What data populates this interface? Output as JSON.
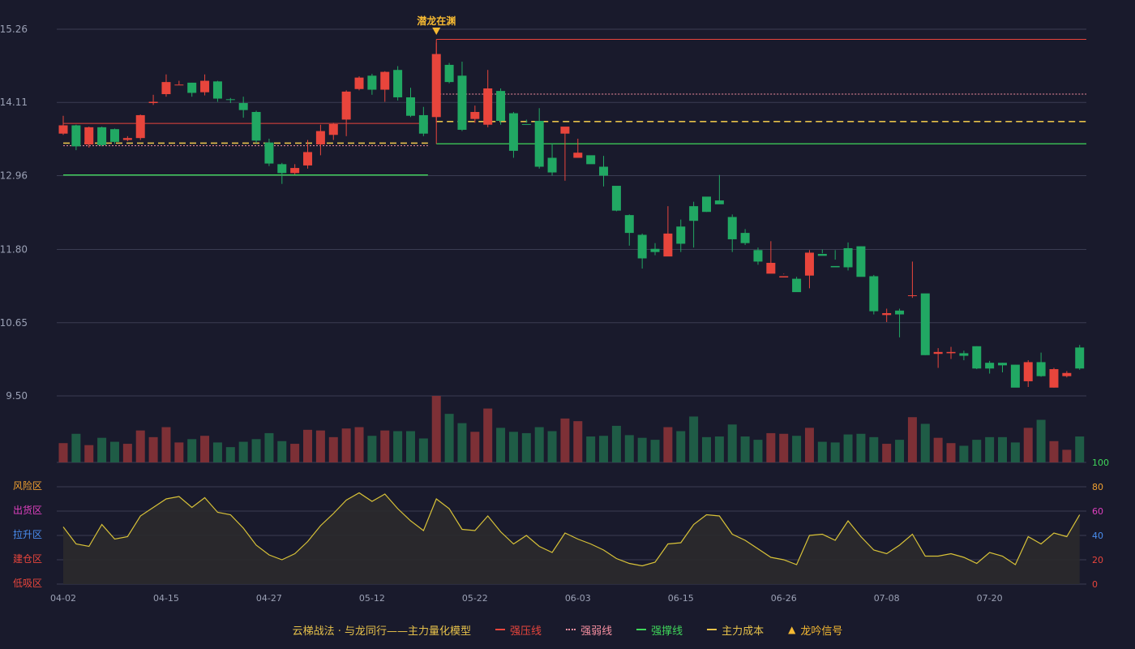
{
  "colors": {
    "background": "#191a2c",
    "up": "#e8453c",
    "down": "#21a863",
    "up_volume": "#7d3036",
    "down_volume": "#1f5c46",
    "grid": "#3a3c52",
    "axis_text": "#9aa0b4",
    "resistance": "#e8453c",
    "weak": "#f58fa0",
    "support": "#3fd65a",
    "cost": "#e6c14a",
    "signal": "#f5b932",
    "osc_line": "#d8c238",
    "osc_fill": "#2b2a2c",
    "zone_risk": "#f0a030",
    "zone_distribute": "#e040c0",
    "zone_rise": "#4a8ef0",
    "zone_build": "#e8453c",
    "zone_absorb": "#e8453c",
    "osc_axis_green": "#3fd65a",
    "osc_axis_orange": "#f0a030",
    "osc_axis_magenta": "#e040c0",
    "osc_axis_blue": "#4a8ef0",
    "osc_axis_red": "#e8453c"
  },
  "chart_data": {
    "type": "candlestick",
    "price_axis": {
      "ticks": [
        "15.26",
        "14.11",
        "12.96",
        "11.80",
        "10.65",
        "9.50"
      ],
      "range": [
        9.5,
        15.26
      ]
    },
    "x_tick_labels": [
      {
        "index": 0,
        "label": "04-02"
      },
      {
        "index": 8,
        "label": "04-15"
      },
      {
        "index": 16,
        "label": "04-27"
      },
      {
        "index": 24,
        "label": "05-12"
      },
      {
        "index": 32,
        "label": "05-22"
      },
      {
        "index": 40,
        "label": "06-03"
      },
      {
        "index": 48,
        "label": "06-15"
      },
      {
        "index": 56,
        "label": "06-26"
      },
      {
        "index": 64,
        "label": "07-08"
      },
      {
        "index": 72,
        "label": "07-20"
      }
    ],
    "candles": [
      [
        13.62,
        13.75,
        13.6,
        13.9
      ],
      [
        13.75,
        13.42,
        13.36,
        13.76
      ],
      [
        13.45,
        13.72,
        13.4,
        13.73
      ],
      [
        13.72,
        13.44,
        13.42,
        13.73
      ],
      [
        13.69,
        13.49,
        13.46,
        13.7
      ],
      [
        13.52,
        13.55,
        13.5,
        13.58
      ],
      [
        13.55,
        13.91,
        13.52,
        13.92
      ],
      [
        14.1,
        14.12,
        14.07,
        14.23
      ],
      [
        14.24,
        14.43,
        14.2,
        14.55
      ],
      [
        14.39,
        14.39,
        14.39,
        14.45
      ],
      [
        14.42,
        14.26,
        14.2,
        14.42
      ],
      [
        14.27,
        14.45,
        14.22,
        14.55
      ],
      [
        14.44,
        14.17,
        14.12,
        14.45
      ],
      [
        14.16,
        14.15,
        14.1,
        14.18
      ],
      [
        14.1,
        13.99,
        13.87,
        14.2
      ],
      [
        13.96,
        13.51,
        13.47,
        13.98
      ],
      [
        13.48,
        13.15,
        13.11,
        13.54
      ],
      [
        13.14,
        13.0,
        12.83,
        13.16
      ],
      [
        13.0,
        13.08,
        12.98,
        13.14
      ],
      [
        13.12,
        13.33,
        13.07,
        13.52
      ],
      [
        13.45,
        13.66,
        13.28,
        13.76
      ],
      [
        13.6,
        13.77,
        13.52,
        13.79
      ],
      [
        13.84,
        14.28,
        13.58,
        14.3
      ],
      [
        14.32,
        14.5,
        14.3,
        14.52
      ],
      [
        14.53,
        14.31,
        14.23,
        14.56
      ],
      [
        14.31,
        14.59,
        14.12,
        14.6
      ],
      [
        14.62,
        14.19,
        14.14,
        14.68
      ],
      [
        14.19,
        13.9,
        13.88,
        14.34
      ],
      [
        13.91,
        13.62,
        13.58,
        14.04
      ],
      [
        13.88,
        14.87,
        13.8,
        15.05
      ],
      [
        14.7,
        14.43,
        14.41,
        14.73
      ],
      [
        14.53,
        13.68,
        13.66,
        14.75
      ],
      [
        13.85,
        13.96,
        13.79,
        14.06
      ],
      [
        13.76,
        14.33,
        13.72,
        14.62
      ],
      [
        14.29,
        13.82,
        13.76,
        14.33
      ],
      [
        13.94,
        13.35,
        13.24,
        13.96
      ],
      [
        13.77,
        13.76,
        13.79,
        13.84
      ],
      [
        13.82,
        13.1,
        13.07,
        14.02
      ],
      [
        13.24,
        13.01,
        12.96,
        13.47
      ],
      [
        13.62,
        13.73,
        12.88,
        13.72
      ],
      [
        13.24,
        13.32,
        13.26,
        13.54
      ],
      [
        13.28,
        13.14,
        13.19,
        13.26
      ],
      [
        13.1,
        12.96,
        12.79,
        13.27
      ],
      [
        12.8,
        12.41,
        12.4,
        12.78
      ],
      [
        12.34,
        12.06,
        11.86,
        12.35
      ],
      [
        12.03,
        11.66,
        11.5,
        12.05
      ],
      [
        11.81,
        11.76,
        11.71,
        11.9
      ],
      [
        11.69,
        12.05,
        11.7,
        12.48
      ],
      [
        12.16,
        11.89,
        11.76,
        12.27
      ],
      [
        12.48,
        12.25,
        11.83,
        12.55
      ],
      [
        12.63,
        12.39,
        12.39,
        12.62
      ],
      [
        12.57,
        12.51,
        12.55,
        12.97
      ],
      [
        12.31,
        11.96,
        11.76,
        12.35
      ],
      [
        12.06,
        11.9,
        11.87,
        12.12
      ],
      [
        11.79,
        11.61,
        11.56,
        11.83
      ],
      [
        11.42,
        11.59,
        11.45,
        11.93
      ],
      [
        11.36,
        11.38,
        11.41,
        11.42
      ],
      [
        11.34,
        11.13,
        11.17,
        11.37
      ],
      [
        11.39,
        11.75,
        11.19,
        11.79
      ],
      [
        11.73,
        11.7,
        11.74,
        11.8
      ],
      [
        11.54,
        11.52,
        11.64,
        11.79
      ],
      [
        11.82,
        11.52,
        11.47,
        11.91
      ],
      [
        11.85,
        11.37,
        11.39,
        11.85
      ],
      [
        11.38,
        10.83,
        10.78,
        11.4
      ],
      [
        10.77,
        10.8,
        10.66,
        10.87
      ],
      [
        10.84,
        10.78,
        10.42,
        10.87
      ],
      [
        11.07,
        11.08,
        11.04,
        11.61
      ],
      [
        11.11,
        10.14,
        10.14,
        11.09
      ],
      [
        10.16,
        10.19,
        9.94,
        10.25
      ],
      [
        10.17,
        10.19,
        10.08,
        10.27
      ],
      [
        10.17,
        10.13,
        10.06,
        10.21
      ],
      [
        10.28,
        9.93,
        9.92,
        10.28
      ],
      [
        10.02,
        9.93,
        9.85,
        10.05
      ],
      [
        10.02,
        9.98,
        9.87,
        10.02
      ],
      [
        9.99,
        9.63,
        9.65,
        9.99
      ],
      [
        9.73,
        10.03,
        9.64,
        10.06
      ],
      [
        10.03,
        9.81,
        9.8,
        10.18
      ],
      [
        9.63,
        9.92,
        9.63,
        9.94
      ],
      [
        9.81,
        9.86,
        9.79,
        9.89
      ],
      [
        10.26,
        9.93,
        9.91,
        10.3
      ]
    ],
    "volume": [
      29,
      43,
      26,
      37,
      31,
      28,
      48,
      38,
      53,
      30,
      35,
      40,
      30,
      23,
      31,
      35,
      44,
      32,
      28,
      49,
      48,
      38,
      51,
      53,
      40,
      48,
      47,
      47,
      36,
      100,
      73,
      59,
      46,
      81,
      52,
      46,
      44,
      53,
      47,
      66,
      62,
      39,
      40,
      55,
      41,
      37,
      34,
      53,
      47,
      69,
      38,
      39,
      57,
      39,
      34,
      44,
      43,
      40,
      52,
      31,
      30,
      42,
      43,
      38,
      28,
      34,
      68,
      58,
      37,
      29,
      25,
      34,
      38,
      38,
      30,
      52,
      64,
      32,
      19,
      39
    ],
    "oscillator": [
      47,
      33,
      31,
      49,
      37,
      39,
      56,
      63,
      70,
      72,
      63,
      71,
      59,
      57,
      46,
      32,
      24,
      20,
      25,
      35,
      48,
      58,
      69,
      75,
      68,
      74,
      62,
      52,
      44,
      70,
      62,
      45,
      44,
      56,
      43,
      33,
      40,
      31,
      26,
      42,
      37,
      33,
      28,
      21,
      17,
      15,
      18,
      33,
      34,
      49,
      57,
      56,
      41,
      36,
      29,
      22,
      20,
      16,
      40,
      41,
      36,
      52,
      39,
      28,
      25,
      32,
      41,
      23,
      23,
      25,
      22,
      17,
      26,
      23,
      16,
      39,
      33,
      42,
      39,
      57
    ],
    "osc_axis_ticks": [
      "100",
      "80",
      "60",
      "40",
      "20",
      "0"
    ],
    "zones": [
      "风险区",
      "出货区",
      "拉升区",
      "建仓区",
      "低吸区"
    ],
    "level_segments": [
      {
        "type": "resistance",
        "value": 13.78,
        "from": 0,
        "to": 28
      },
      {
        "type": "weak",
        "value": 13.43,
        "from": 0,
        "to": 28
      },
      {
        "type": "cost",
        "value": 13.47,
        "from": 0,
        "to": 28
      },
      {
        "type": "support",
        "value": 12.97,
        "from": 0,
        "to": 28
      },
      {
        "type": "resistance",
        "value": 15.1,
        "from": 29,
        "to": 79
      },
      {
        "type": "weak",
        "value": 14.24,
        "from": 29,
        "to": 79
      },
      {
        "type": "cost",
        "value": 13.81,
        "from": 29,
        "to": 79
      },
      {
        "type": "support",
        "value": 13.46,
        "from": 29,
        "to": 79
      }
    ],
    "signals": [
      {
        "index": 29,
        "label": "潜龙在渊"
      }
    ],
    "legend": {
      "title": "云梯战法 · 与龙同行——主力量化模型",
      "items": [
        {
          "key": "resistance",
          "label": "强压线",
          "style": "solid"
        },
        {
          "key": "weak",
          "label": "强弱线",
          "style": "dot"
        },
        {
          "key": "support",
          "label": "强撑线",
          "style": "solid"
        },
        {
          "key": "cost",
          "label": "主力成本",
          "style": "dash"
        },
        {
          "key": "signal",
          "label": "龙吟信号",
          "style": "triangle"
        }
      ]
    }
  }
}
